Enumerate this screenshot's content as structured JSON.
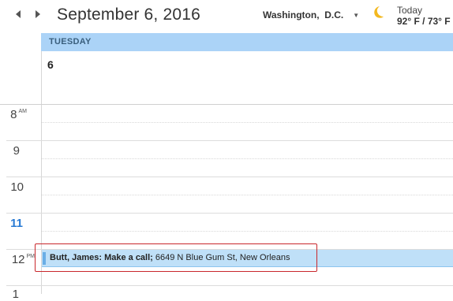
{
  "header": {
    "date_title": "September 6, 2016",
    "location": "Washington,  D.C.",
    "weather_icon": "moon-icon",
    "today_label": "Today",
    "temperatures": "92° F / 73° F"
  },
  "day": {
    "name": "TUESDAY",
    "number": "6"
  },
  "hours": [
    {
      "label": "8",
      "suffix": "AM"
    },
    {
      "label": "9",
      "suffix": ""
    },
    {
      "label": "10",
      "suffix": ""
    },
    {
      "label": "11",
      "suffix": ""
    },
    {
      "label": "12",
      "suffix": "PM"
    },
    {
      "label": "1",
      "suffix": ""
    }
  ],
  "event": {
    "title": "Butt, James: Make a call;",
    "location": " 6649 N Blue Gum St, New Orleans"
  },
  "colors": {
    "day_header": "#abd3f7",
    "event_bg": "#bfe0f8",
    "current_hour": "#2a7bd4",
    "highlight": "#c9272c"
  }
}
